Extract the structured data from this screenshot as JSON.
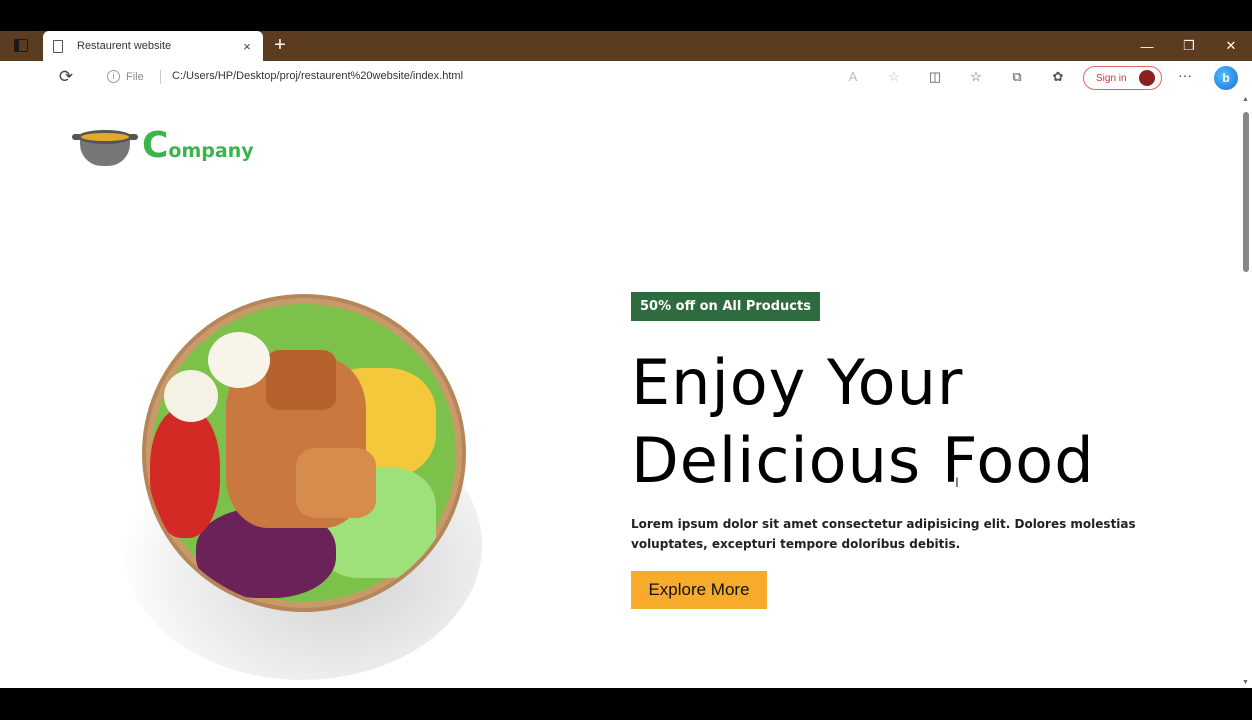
{
  "browser": {
    "tab": {
      "title": "Restaurent website",
      "close": "×"
    },
    "new_tab": "+",
    "window_controls": {
      "minimize": "—",
      "restore": "❐",
      "close": "✕"
    },
    "address_bar": {
      "info_label": "File",
      "url": "C:/Users/HP/Desktop/proj/restaurent%20website/index.html"
    },
    "signin_label": "Sign in",
    "more_label": "···",
    "copilot_label": "b"
  },
  "page": {
    "logo": {
      "initial": "C",
      "rest": "ompany"
    },
    "badge": "50% off on All Products",
    "headline": {
      "line1": "Enjoy Your",
      "line2": "Delicious Food"
    },
    "description": "Lorem ipsum dolor sit amet consectetur adipisicing elit. Dolores molestias voluptates, excepturi tempore doloribus debitis.",
    "cta_label": "Explore More"
  },
  "colors": {
    "titlebar": "#5c3c20",
    "logo_green": "#3cb44b",
    "badge_bg": "#2e6b3f",
    "cta_bg": "#f6ab2a"
  },
  "icons": {
    "reload": "reload-icon",
    "read_aloud": "read-aloud-icon",
    "favorite": "star-icon",
    "split_screen": "split-screen-icon",
    "favorites": "favorites-icon",
    "collections": "collections-icon",
    "extensions": "extensions-icon"
  }
}
